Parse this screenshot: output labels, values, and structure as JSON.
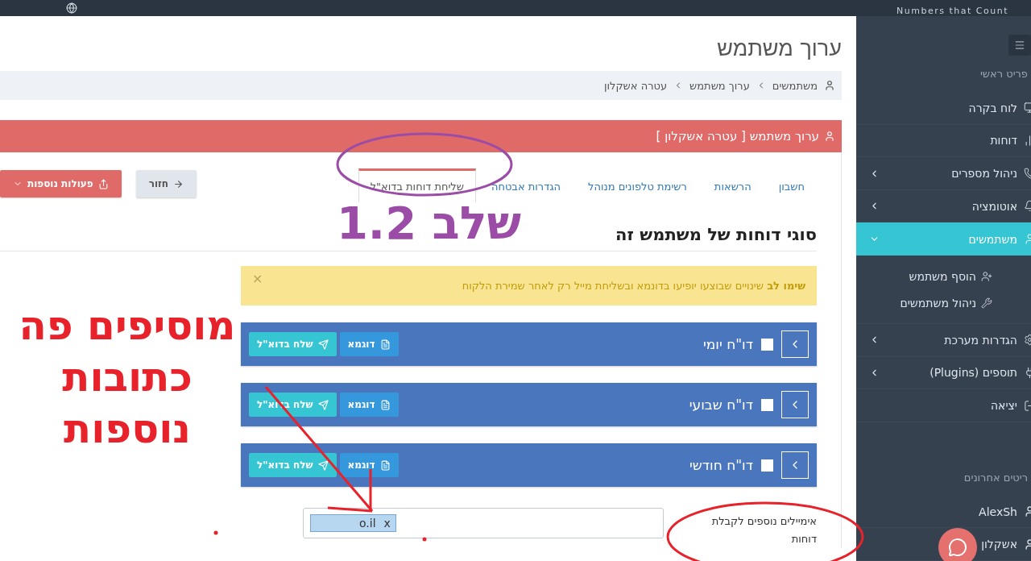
{
  "logo": {
    "tagline": "Numbers that Count"
  },
  "page": {
    "title": "ערוך משתמש"
  },
  "breadcrumb": [
    {
      "label": "משתמשים"
    },
    {
      "label": "ערוך משתמש"
    },
    {
      "label": "עטרה אשקלון"
    }
  ],
  "panel": {
    "title": "ערוך משתמש [ עטרה אשקלון ]"
  },
  "tabs": [
    {
      "label": "חשבון",
      "selected": false
    },
    {
      "label": "הרשאות",
      "selected": false
    },
    {
      "label": "רשימת טלפונים מנוהל",
      "selected": false
    },
    {
      "label": "הגדרות אבטחה",
      "selected": false
    },
    {
      "label": "שליחת דוחות בדוא\"ל",
      "selected": true
    }
  ],
  "actions": {
    "back": "חזור",
    "more": "פעולות נוספות"
  },
  "section_title": "סוגי דוחות של משתמש זה",
  "alert": {
    "strong": "שימו לב",
    "text": "שינויים שבוצעו יופיעו בדונמא ובשליחת מייל רק לאחר שמירת הלקוח",
    "close": "×"
  },
  "reports": [
    {
      "name": "דו\"ח יומי",
      "checked": false,
      "sample": "דוגמא",
      "send": "שלח בדוא\"ל"
    },
    {
      "name": "דו\"ח שבועי",
      "checked": false,
      "sample": "דוגמא",
      "send": "שלח בדוא\"ל"
    },
    {
      "name": "דו\"ח חודשי",
      "checked": false,
      "sample": "דוגמא",
      "send": "שלח בדוא\"ל"
    }
  ],
  "extra_emails": {
    "label": "אימיילים נוספים לקבלת דוחות",
    "tags": [
      {
        "text": "o.il",
        "remove": "x"
      }
    ]
  },
  "sidebar": {
    "main_heading": "פריט ראשי",
    "recent_heading": "ריטים אחרונים",
    "items": [
      {
        "kind": "link",
        "label": "לוח בקרה",
        "selected": false
      },
      {
        "kind": "link",
        "label": "דוחות",
        "selected": false
      },
      {
        "kind": "group",
        "label": "ניהול מספרים",
        "selected": false,
        "expanded": false
      },
      {
        "kind": "group",
        "label": "אוטומציה",
        "selected": false,
        "expanded": false
      },
      {
        "kind": "group",
        "label": "משתמשים",
        "selected": true,
        "expanded": true,
        "children": [
          {
            "label": "הוסף משתמש"
          },
          {
            "label": "ניהול משתמשים"
          }
        ]
      },
      {
        "kind": "group",
        "label": "הגדרות מערכת",
        "selected": false,
        "expanded": false
      },
      {
        "kind": "group",
        "label": "תוספים (Plugins)",
        "selected": false,
        "expanded": false
      },
      {
        "kind": "link",
        "label": "יציאה",
        "selected": false
      }
    ],
    "recent": [
      {
        "label": "AlexSh"
      },
      {
        "label": "אשקלון"
      }
    ]
  },
  "annotations": [
    {
      "text": "שלב 1.2",
      "color": "#9b4ca6"
    },
    {
      "text": "מוסיפים פה כתובות נוספות",
      "color": "#e8222a"
    }
  ]
}
